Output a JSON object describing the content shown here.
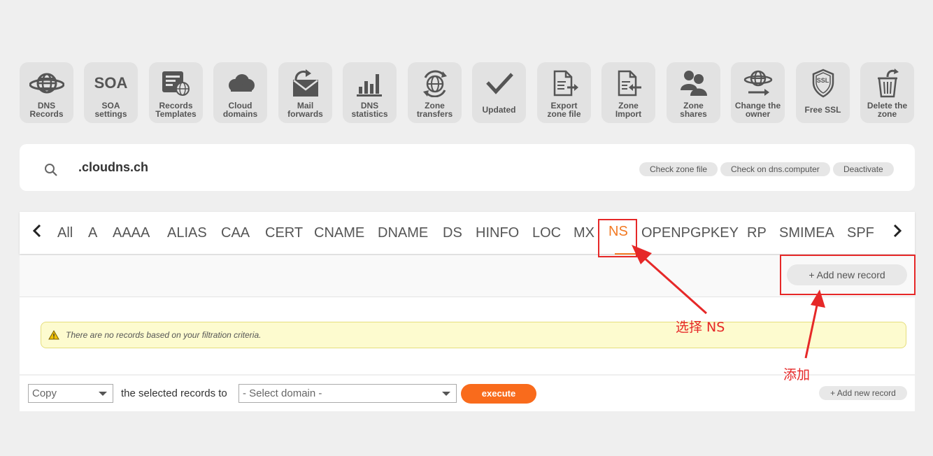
{
  "tools": [
    {
      "label": "DNS\nRecords",
      "icon": "globe-icon"
    },
    {
      "label": "SOA\nsettings",
      "icon": "soa-text-icon",
      "icon_text": "SOA"
    },
    {
      "label": "Records\nTemplates",
      "icon": "template-icon"
    },
    {
      "label": "Cloud\ndomains",
      "icon": "cloud-icon"
    },
    {
      "label": "Mail\nforwards",
      "icon": "mail-forward-icon"
    },
    {
      "label": "DNS\nstatistics",
      "icon": "bar-chart-icon"
    },
    {
      "label": "Zone\ntransfers",
      "icon": "zone-transfer-icon"
    },
    {
      "label": "Updated",
      "icon": "checkmark-icon"
    },
    {
      "label": "Export\nzone file",
      "icon": "export-file-icon"
    },
    {
      "label": "Zone\nImport",
      "icon": "import-file-icon"
    },
    {
      "label": "Zone\nshares",
      "icon": "users-icon"
    },
    {
      "label": "Change the\nowner",
      "icon": "change-owner-icon"
    },
    {
      "label": "Free SSL",
      "icon": "ssl-shield-icon",
      "icon_text": "SSL"
    },
    {
      "label": "Delete the\nzone",
      "icon": "trash-icon"
    }
  ],
  "zone": {
    "name": ".cloudns.ch",
    "actions": [
      "Check zone file",
      "Check on dns.computer",
      "Deactivate"
    ]
  },
  "record_tabs": [
    "All",
    "A",
    "AAAA",
    "ALIAS",
    "CAA",
    "CERT",
    "CNAME",
    "DNAME",
    "DS",
    "HINFO",
    "LOC",
    "MX",
    "NS",
    "OPENPGPKEY",
    "RP",
    "SMIMEA",
    "SPF"
  ],
  "active_tab": "NS",
  "nav": {
    "prev": "‹",
    "next": "›"
  },
  "add_record_label": "+ Add new record",
  "alert": {
    "message": "There are no records based on your filtration criteria."
  },
  "bottom": {
    "action_select": "Copy",
    "middle_text": "the selected records to",
    "domain_select": "- Select domain -",
    "execute_label": "execute",
    "add_record_label": "+ Add new record"
  },
  "annotations": {
    "select_ns": "选择 NS",
    "add": "添加"
  },
  "colors": {
    "accent": "#f27a24",
    "execute": "#f96b1c",
    "annotation_red": "#e62828",
    "alert_bg": "#fdfbcf"
  }
}
